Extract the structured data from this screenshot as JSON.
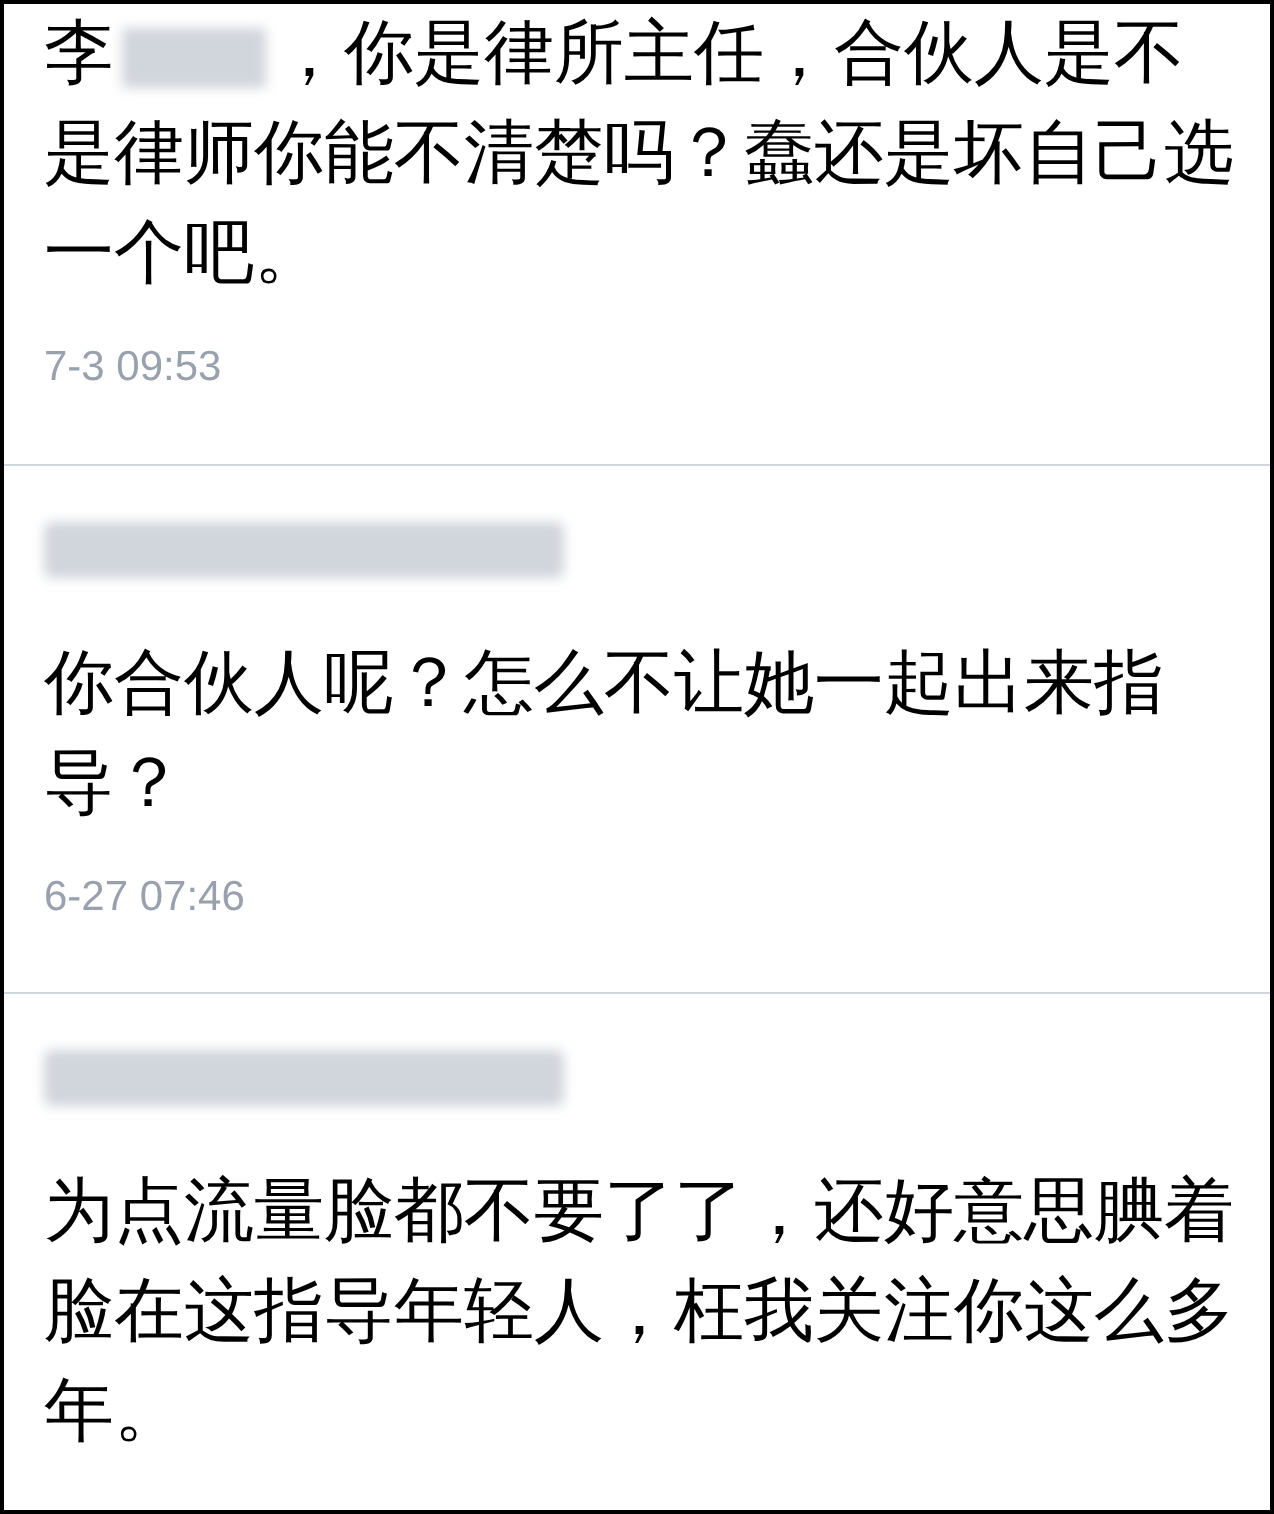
{
  "comments": [
    {
      "kind": "inline_name",
      "prefix": "李",
      "text": "，你是律所主任，合伙人是不是律师你能不清楚吗？蠢还是坏自己选一个吧。",
      "time": "7-3 09:53"
    },
    {
      "kind": "name_line",
      "text": "你合伙人呢？怎么不让她一起出来指导？",
      "time": "6-27 07:46"
    },
    {
      "kind": "name_line",
      "text": "为点流量脸都不要了了，还好意思腆着脸在这指导年轻人，枉我关注你这么多年。"
    }
  ]
}
